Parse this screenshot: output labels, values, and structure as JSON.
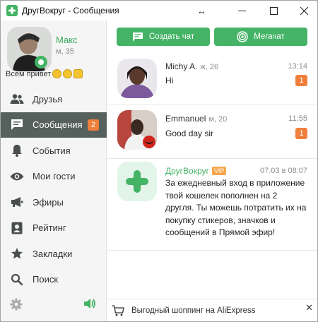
{
  "window": {
    "title": "ДругВокруг - Сообщения",
    "resize_glyph": "↔"
  },
  "profile": {
    "name": "Макс",
    "sub": "м, 35",
    "status": "Всем привет"
  },
  "nav": [
    {
      "label": "Друзья",
      "icon": "friends-icon"
    },
    {
      "label": "Сообщения",
      "icon": "messages-icon",
      "badge": "2",
      "active": true
    },
    {
      "label": "События",
      "icon": "bell-icon"
    },
    {
      "label": "Мои гости",
      "icon": "eye-icon"
    },
    {
      "label": "Эфиры",
      "icon": "megaphone-icon"
    },
    {
      "label": "Рейтинг",
      "icon": "rating-icon"
    },
    {
      "label": "Закладки",
      "icon": "star-icon"
    },
    {
      "label": "Поиск",
      "icon": "search-icon"
    }
  ],
  "actions": {
    "create_chat": "Создать чат",
    "megachat": "Мегачат"
  },
  "chats": [
    {
      "name": "Michy A.",
      "meta": "ж, 26",
      "time": "13:14",
      "text": "Hi",
      "badge": "1"
    },
    {
      "name": "Emmanuel",
      "meta": "м, 20",
      "time": "11:55",
      "text": "Good day sir",
      "badge": "1"
    }
  ],
  "system_message": {
    "name": "ДругВокруг",
    "tag": "VIP",
    "time": "07.03 в 08:07",
    "text": "За ежедневный вход в приложение твой кошелек пополнен на 2 другля. Ты можешь потратить их на покупку стикеров, значков и сообщений в Прямой эфир!"
  },
  "ad": {
    "text": "Выгодный шоппинг на AliExpress",
    "close": "✕"
  },
  "colors": {
    "accent": "#44b365",
    "badge": "#f07f3c",
    "sidebar_active": "#56605c"
  }
}
